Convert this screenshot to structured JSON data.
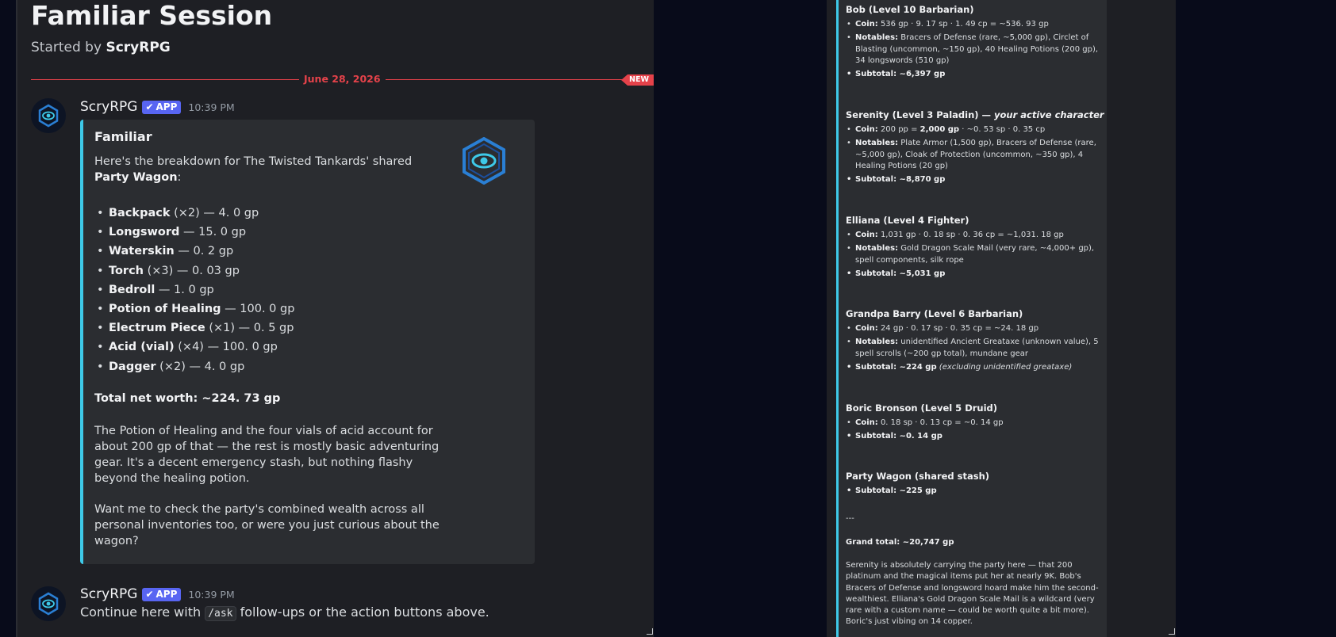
{
  "thread": {
    "title": "Familiar Session",
    "started_by_prefix": "Started by ",
    "started_by_user": "ScryRPG"
  },
  "divider": {
    "date": "June 28, 2026",
    "new_badge": "NEW"
  },
  "message1": {
    "author": "ScryRPG",
    "badge": "APP",
    "time": "10:39 PM",
    "embed": {
      "title": "Familiar",
      "intro_prefix": "Here's the breakdown for The Twisted Tankards' shared ",
      "intro_bold": "Party Wagon",
      "intro_suffix": ":",
      "items": [
        {
          "name": "Backpack",
          "rest": " (×2) — 4. 0 gp"
        },
        {
          "name": "Longsword",
          "rest": " — 15. 0 gp"
        },
        {
          "name": "Waterskin",
          "rest": " — 0. 2 gp"
        },
        {
          "name": "Torch",
          "rest": " (×3) — 0. 03 gp"
        },
        {
          "name": "Bedroll",
          "rest": " — 1. 0 gp"
        },
        {
          "name": "Potion of Healing",
          "rest": " — 100. 0 gp"
        },
        {
          "name": "Electrum Piece",
          "rest": " (×1) — 0. 5 gp"
        },
        {
          "name": "Acid (vial)",
          "rest": " (×4) — 100. 0 gp"
        },
        {
          "name": "Dagger",
          "rest": " (×2) — 4. 0 gp"
        }
      ],
      "total": "Total net worth: ~224. 73 gp",
      "paragraph1": "The Potion of Healing and the four vials of acid account for about 200 gp of that — the rest is mostly basic adventuring gear. It's a decent emergency stash, but nothing flashy beyond the healing potion.",
      "paragraph2": "Want me to check the party's combined wealth across all personal inventories too, or were you just curious about the wagon?"
    }
  },
  "message2": {
    "author": "ScryRPG",
    "badge": "APP",
    "time": "10:39 PM",
    "text_prefix": "Continue here with ",
    "code": "/ask",
    "text_suffix": " follow-ups or the action buttons above."
  },
  "right": {
    "bob": {
      "title": "Bob (Level 10 Barbarian)",
      "coin_label": "Coin:",
      "coin": " 536 gp · 9. 17 sp · 1. 49 cp = ~536. 93 gp",
      "notables_label": "Notables:",
      "notables": " Bracers of Defense (rare, ~5,000 gp), Circlet of Blasting (uncommon, ~150 gp), 40 Healing Potions (200 gp), 34 longswords (510 gp)",
      "subtotal": "Subtotal: ~6,397 gp"
    },
    "serenity": {
      "title": "Serenity (Level 3 Paladin) — ",
      "title_italic": "your active character",
      "coin_label": "Coin:",
      "coin_a": " 200 pp = ",
      "coin_bold": "2,000 gp",
      "coin_b": " · ~0. 53 sp · 0. 35 cp",
      "notables_label": "Notables:",
      "notables": " Plate Armor (1,500 gp), Bracers of Defense (rare, ~5,000 gp), Cloak of Protection (uncommon, ~350 gp), 4 Healing Potions (20 gp)",
      "subtotal": "Subtotal: ~8,870 gp"
    },
    "elliana": {
      "title": "Elliana (Level 4 Fighter)",
      "coin_label": "Coin:",
      "coin": " 1,031 gp · 0. 18 sp · 0. 36 cp = ~1,031. 18 gp",
      "notables_label": "Notables:",
      "notables": " Gold Dragon Scale Mail (very rare, ~4,000+ gp), spell components, silk rope",
      "subtotal": "Subtotal: ~5,031 gp"
    },
    "barry": {
      "title": "Grandpa Barry (Level 6 Barbarian)",
      "coin_label": "Coin:",
      "coin": " 24 gp · 0. 17 sp · 0. 35 cp = ~24. 18 gp",
      "notables_label": "Notables:",
      "notables": " unidentified Ancient Greataxe (unknown value), 5 spell scrolls (~200 gp total), mundane gear",
      "subtotal": "Subtotal: ~224 gp",
      "subtotal_note": " (excluding unidentified greataxe)"
    },
    "boric": {
      "title": "Boric Bronson (Level 5 Druid)",
      "coin_label": "Coin:",
      "coin": " 0. 18 sp · 0. 13 cp = ~0. 14 gp",
      "subtotal": "Subtotal: ~0. 14 gp"
    },
    "wagon": {
      "title": "Party Wagon (shared stash)",
      "subtotal": "Subtotal: ~225 gp"
    },
    "separator": "---",
    "grand_total": "Grand total: ~20,747 gp",
    "closing": "Serenity is absolutely carrying the party here — that 200 platinum and the magical items put her at nearly 9K. Bob's Bracers of Defense and longsword hoard make him the second-wealthiest. Elliana's Gold Dragon Scale Mail is a wildcard (very rare with a custom name — could be worth quite a bit more). Boric's just vibing on 14 copper."
  },
  "colors": {
    "accent": "#3ec9e8",
    "new_red": "#e5424a",
    "app_badge": "#5865f2"
  }
}
